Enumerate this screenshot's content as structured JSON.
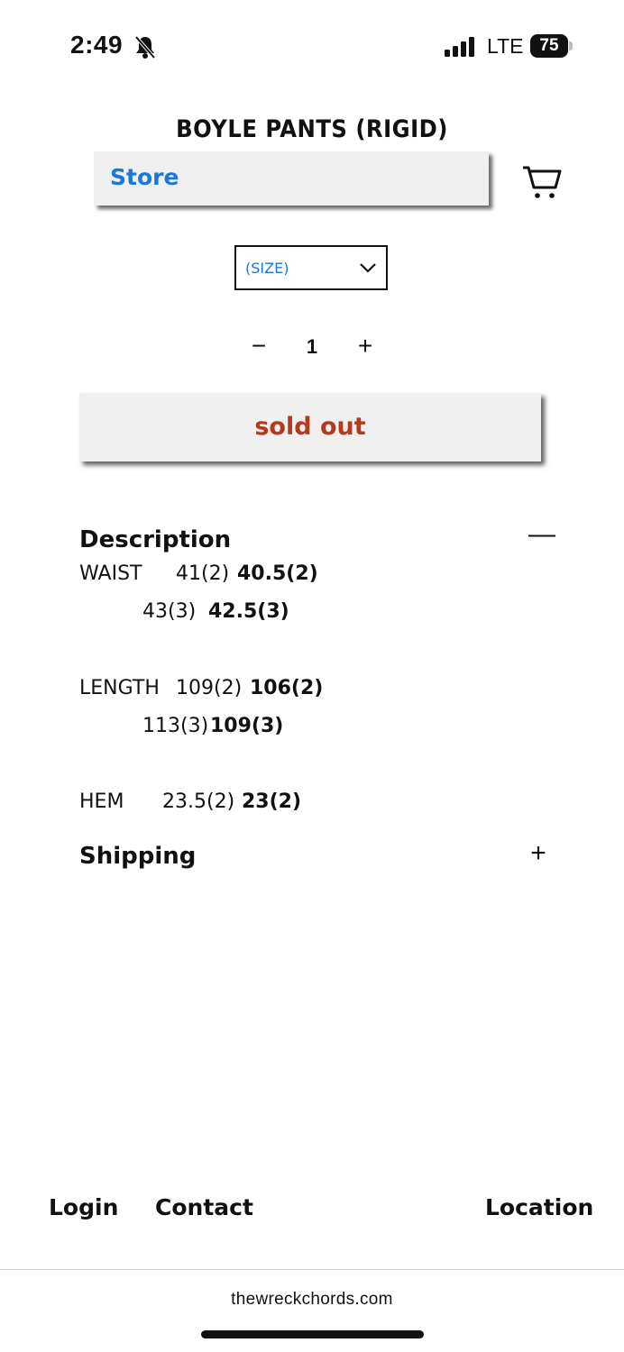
{
  "status_bar": {
    "time": "2:49",
    "carrier": "LTE",
    "battery": "75"
  },
  "product": {
    "title": "BOYLE PANTS (RIGID)"
  },
  "nav": {
    "store_label": "Store"
  },
  "options": {
    "size_selected": "(SIZE)",
    "quantity": "1",
    "minus": "−",
    "plus": "+"
  },
  "purchase": {
    "button_label": "sold out"
  },
  "description": {
    "heading": "Description",
    "toggle": "—",
    "waist": {
      "label": "WAIST",
      "r1a": "41(2)",
      "r1b": "40.5(2)",
      "r2a": "43(3)",
      "r2b": "42.5(3)"
    },
    "length": {
      "label": "LENGTH",
      "r1a": "109(2)",
      "r1b": "106(2)",
      "r2a": "113(3)",
      "r2b": "109(3)"
    },
    "hem": {
      "label": "HEM",
      "r1a": "23.5(2)",
      "r1b": "23(2)"
    }
  },
  "shipping": {
    "heading": "Shipping",
    "toggle": "+"
  },
  "footer": {
    "login": "Login",
    "contact": "Contact",
    "location": "Location"
  },
  "browser": {
    "url": "thewreckchords.com"
  },
  "colors": {
    "link_blue": "#1a78d8",
    "sold_out_red": "#b53a1c",
    "button_bg": "#f0f0f0"
  },
  "icons": [
    "bell-slash-icon",
    "signal-icon",
    "battery-icon",
    "cart-icon",
    "chevron-down-icon"
  ]
}
